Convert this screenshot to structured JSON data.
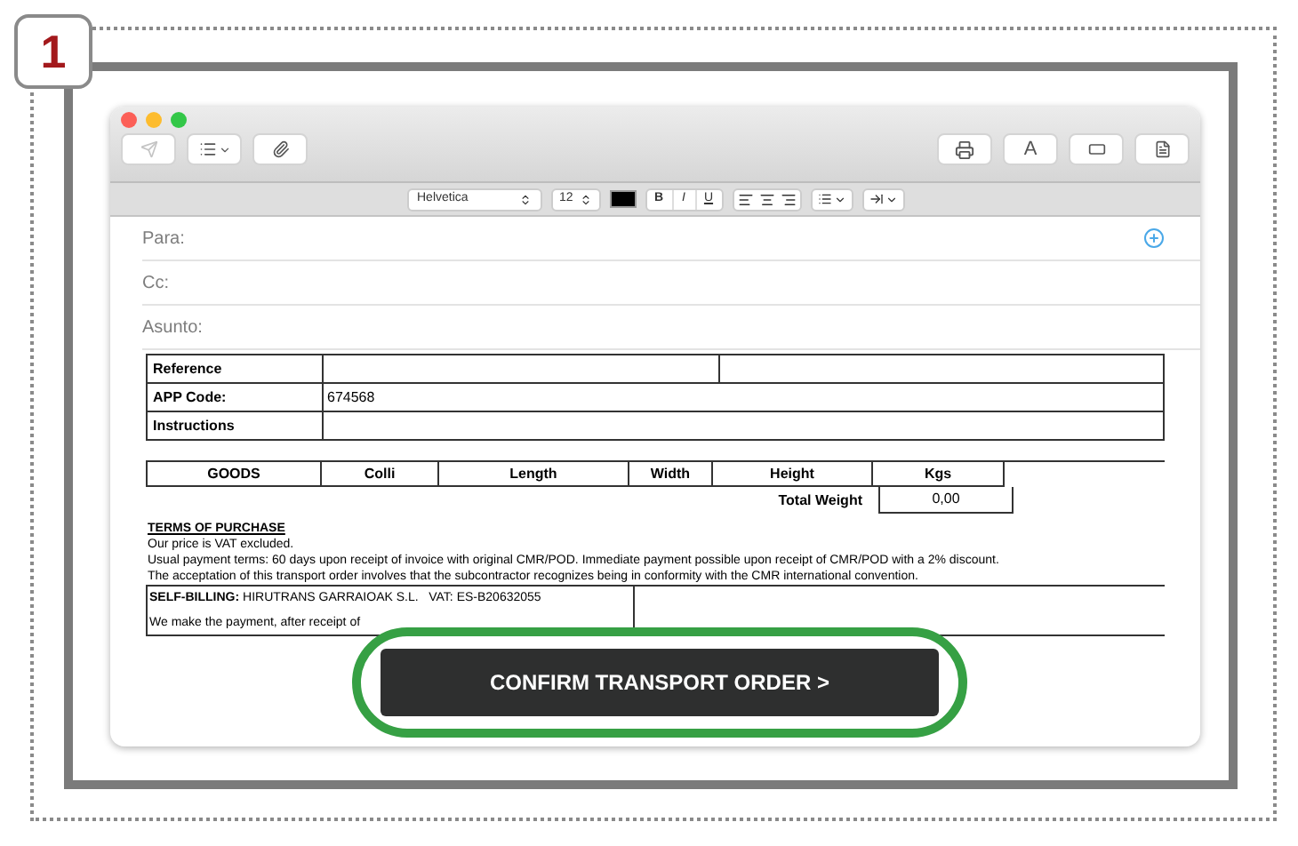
{
  "step_badge": "1",
  "toolbar": {
    "fonts_button": "A"
  },
  "format_bar": {
    "font": "Helvetica",
    "size": "12",
    "bold": "B",
    "italic": "I",
    "underline": "U"
  },
  "header_fields": [
    {
      "label": "Para:"
    },
    {
      "label": "Cc:"
    },
    {
      "label": "Asunto:"
    }
  ],
  "info_rows": [
    {
      "label": "Reference",
      "kind": "split"
    },
    {
      "label": "APP Code:",
      "value": "674568",
      "kind": "single"
    },
    {
      "label": "Instructions",
      "kind": "single"
    }
  ],
  "goods_table": {
    "columns": [
      "GOODS",
      "Colli",
      "Length",
      "Width",
      "Height",
      "Kgs"
    ],
    "total_label": "Total Weight",
    "total_value": "0,00"
  },
  "terms": {
    "title": "TERMS OF PURCHASE",
    "lines": [
      "Our price is VAT excluded.",
      "Usual payment terms: 60 days upon receipt of invoice with original CMR/POD. Immediate payment possible upon receipt of CMR/POD with a 2% discount.",
      "The acceptation of this transport order involves that the subcontractor recognizes being in conformity with the CMR international convention."
    ]
  },
  "self_billing": {
    "line": "**SELF-BILLING:** HIRUTRANS GARRAIOAK S.L.   VAT: ES-B20632055",
    "note": "We make the payment, after receipt of"
  },
  "confirm_button": "CONFIRM TRANSPORT ORDER >"
}
